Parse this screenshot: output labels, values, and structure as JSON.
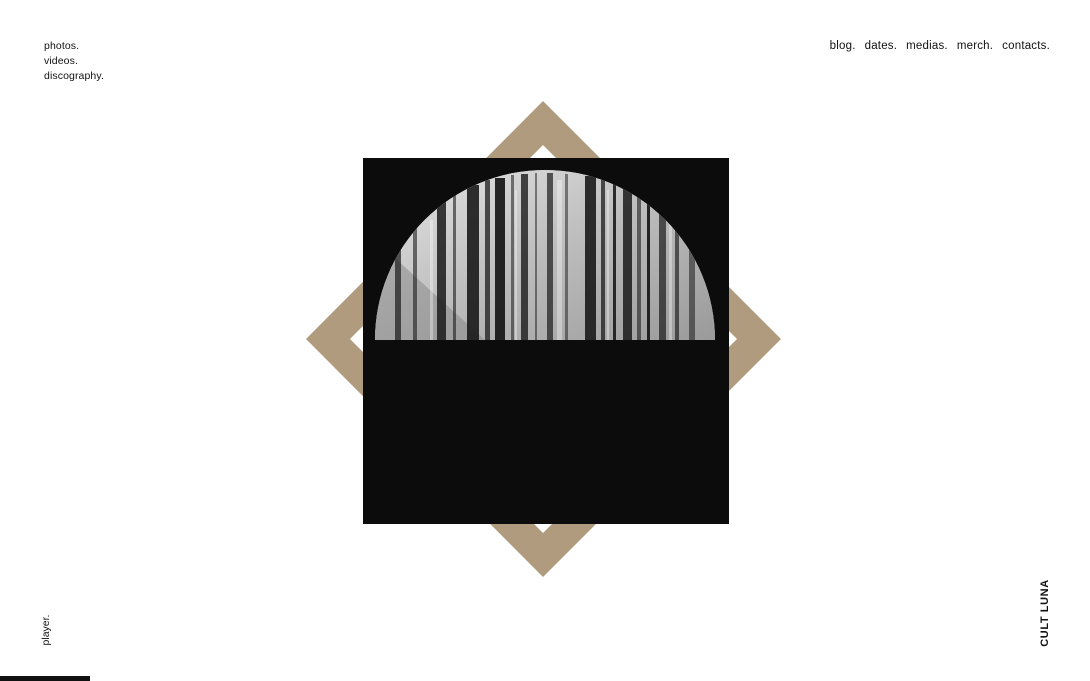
{
  "nav_left": {
    "items": [
      {
        "label": "photos."
      },
      {
        "label": "videos."
      },
      {
        "label": "discography."
      }
    ]
  },
  "nav_right": {
    "items": [
      {
        "label": "blog."
      },
      {
        "label": "dates."
      },
      {
        "label": "medias."
      },
      {
        "label": "merch."
      },
      {
        "label": "contacts."
      }
    ]
  },
  "player": {
    "label": "player."
  },
  "brand": {
    "name": "CULT LUNA"
  },
  "colors": {
    "accent_gold": "#b09b7e",
    "album_black": "#0c0c0c",
    "text": "#111111",
    "background": "#ffffff"
  }
}
